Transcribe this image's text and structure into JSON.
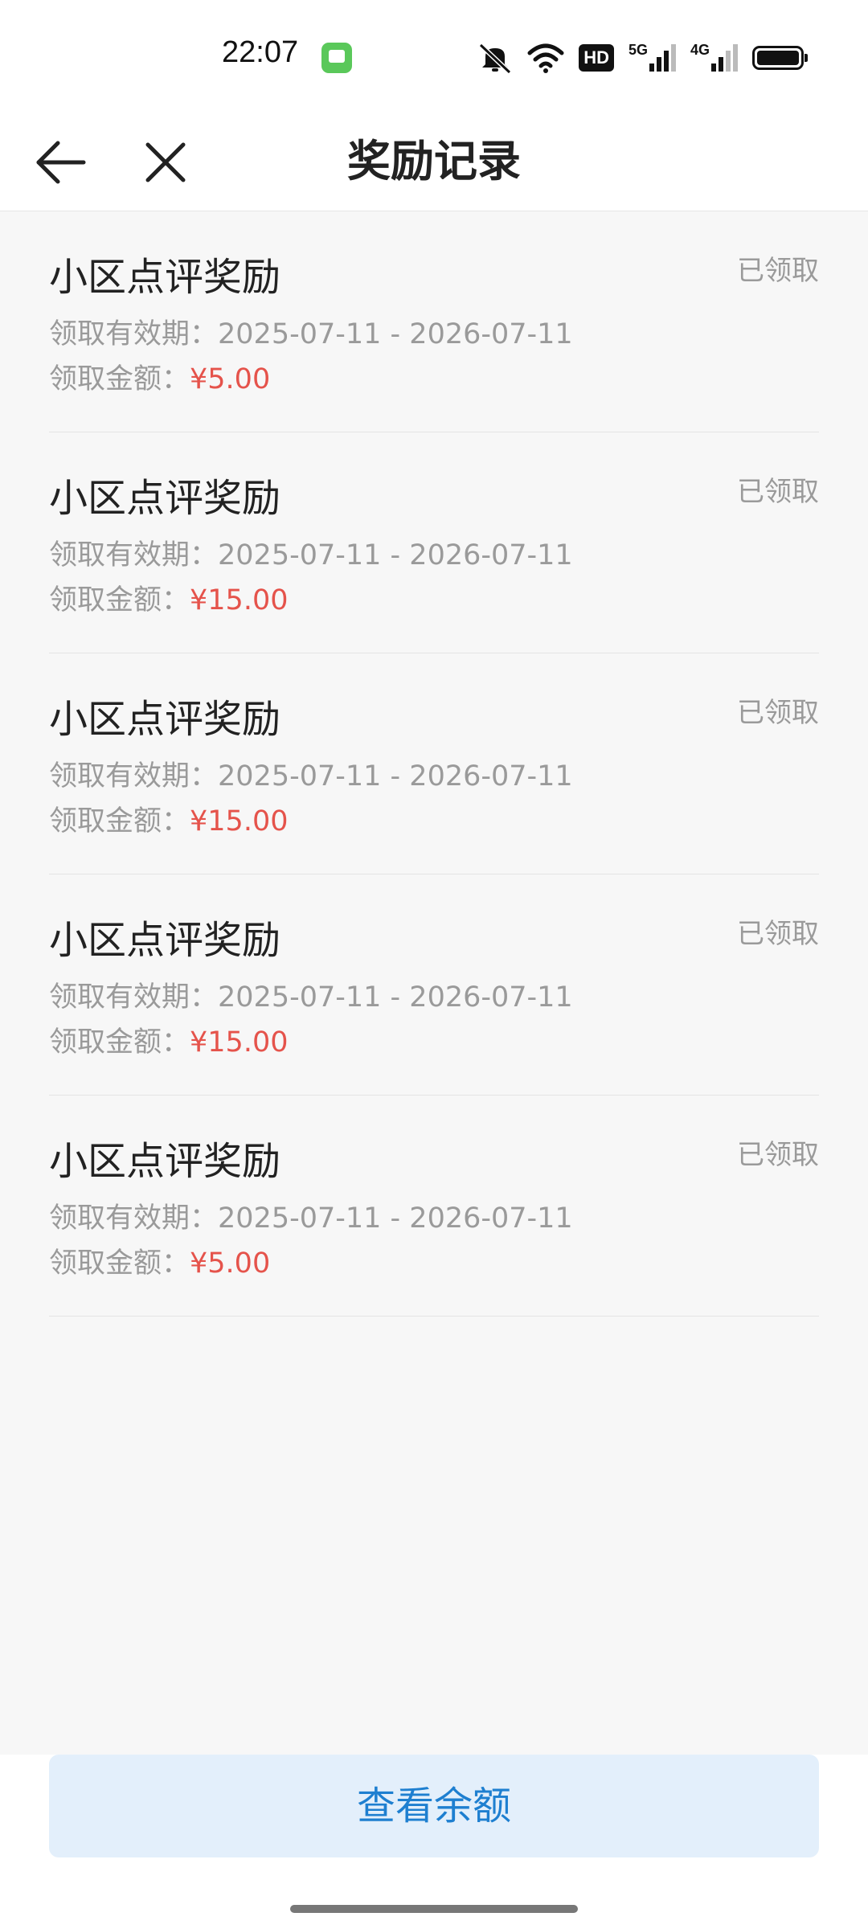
{
  "status_bar": {
    "time": "22:07",
    "hd_label": "HD",
    "network_1": "5G",
    "network_2": "4G",
    "icons": [
      "message-app-icon",
      "mute-icon",
      "wifi-icon",
      "hd-icon",
      "signal-5g-icon",
      "signal-4g-icon",
      "battery-icon"
    ]
  },
  "header": {
    "title": "奖励记录"
  },
  "rewards": [
    {
      "title": "小区点评奖励",
      "status": "已领取",
      "period_label": "领取有效期：",
      "period": "2025-07-11 - 2026-07-11",
      "amount_label": "领取金额：",
      "amount": "¥5.00"
    },
    {
      "title": "小区点评奖励",
      "status": "已领取",
      "period_label": "领取有效期：",
      "period": "2025-07-11 - 2026-07-11",
      "amount_label": "领取金额：",
      "amount": "¥15.00"
    },
    {
      "title": "小区点评奖励",
      "status": "已领取",
      "period_label": "领取有效期：",
      "period": "2025-07-11 - 2026-07-11",
      "amount_label": "领取金额：",
      "amount": "¥15.00"
    },
    {
      "title": "小区点评奖励",
      "status": "已领取",
      "period_label": "领取有效期：",
      "period": "2025-07-11 - 2026-07-11",
      "amount_label": "领取金额：",
      "amount": "¥15.00"
    },
    {
      "title": "小区点评奖励",
      "status": "已领取",
      "period_label": "领取有效期：",
      "period": "2025-07-11 - 2026-07-11",
      "amount_label": "领取金额：",
      "amount": "¥5.00"
    }
  ],
  "footer": {
    "button_label": "查看余额"
  },
  "colors": {
    "amount": "#e5534b",
    "button_bg": "#e3effb",
    "button_text": "#1e7fd0",
    "list_bg": "#f7f7f7"
  }
}
